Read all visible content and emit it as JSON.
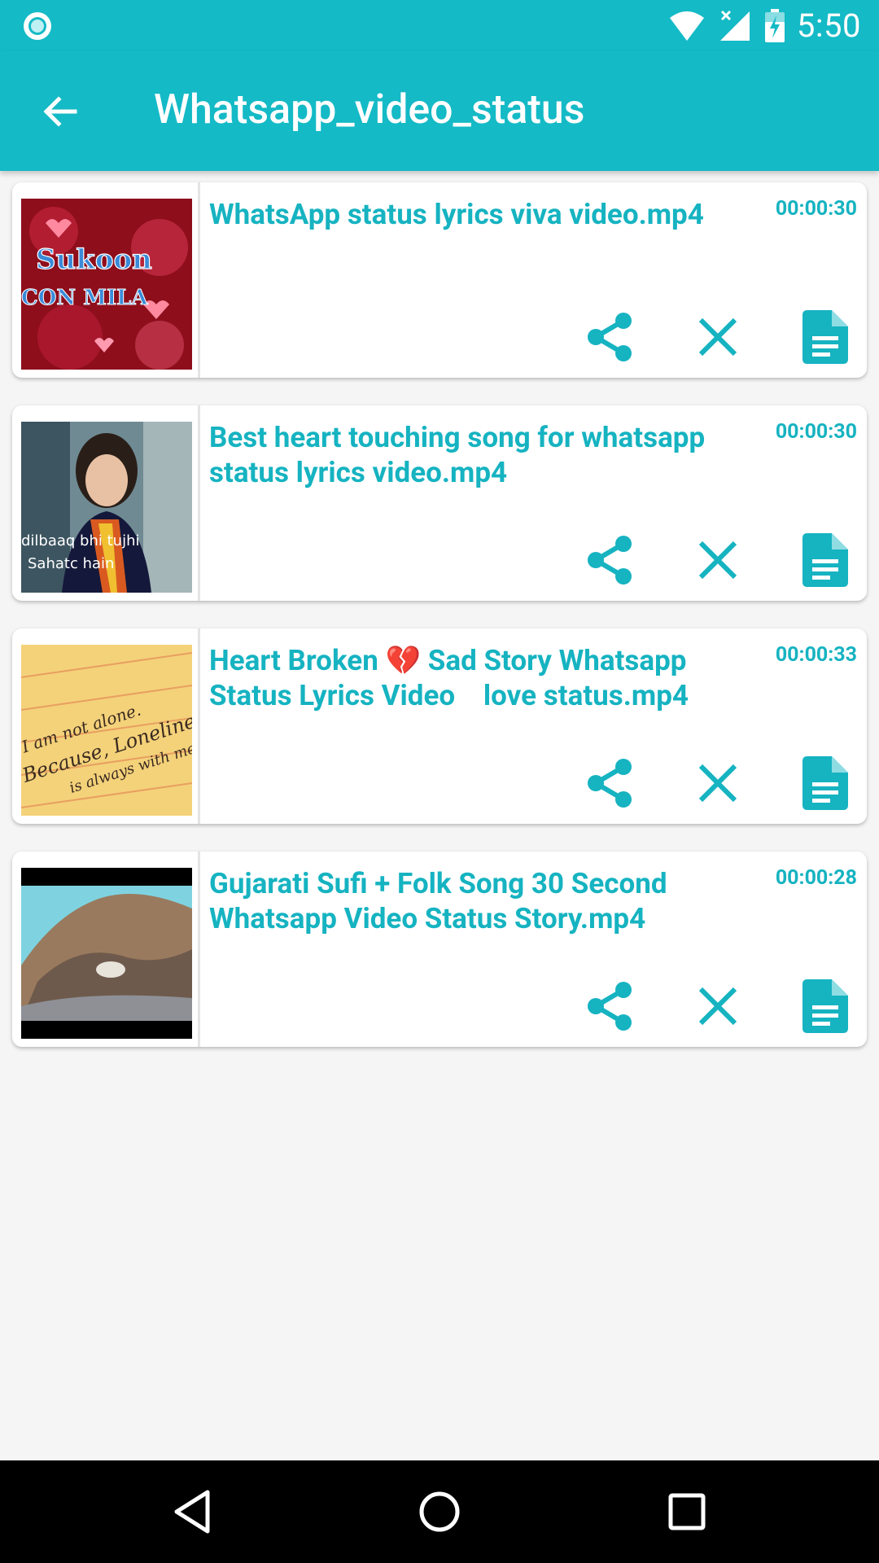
{
  "status_bar": {
    "time": "5:50"
  },
  "app_bar": {
    "title": "Whatsapp_video_status"
  },
  "videos": [
    {
      "title": "WhatsApp status lyrics viva video.mp4",
      "duration": "00:00:30",
      "thumb_text": [
        "Sukoon",
        "CON MILA"
      ]
    },
    {
      "title": "Best heart touching song for whatsapp status lyrics video.mp4",
      "duration": "00:00:30",
      "thumb_text": [
        "dilbaaq bhi tujhi",
        "Sahatc hain"
      ]
    },
    {
      "title": "Heart Broken 💔 Sad Story Whatsapp Status Lyrics Video    love status.mp4",
      "duration": "00:00:33",
      "thumb_text": [
        "I am not alone.",
        "Because, Loneliness",
        "is always with me."
      ]
    },
    {
      "title": "Gujarati Sufi + Folk Song 30 Second Whatsapp Video Status Story.mp4",
      "duration": "00:00:28",
      "thumb_text": []
    }
  ],
  "colors": {
    "accent": "#14bac6",
    "title_text": "#16b3c1"
  }
}
